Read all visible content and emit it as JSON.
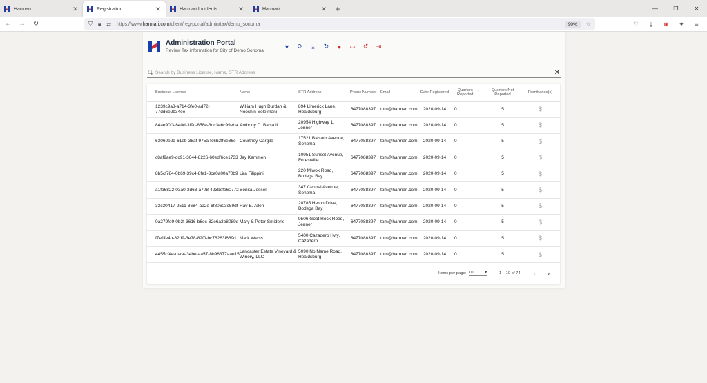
{
  "browser": {
    "tabs": [
      {
        "label": "Harmari",
        "active": false
      },
      {
        "label": "Registration",
        "active": true
      },
      {
        "label": "Harmari Incidents",
        "active": false
      },
      {
        "label": "Harmari",
        "active": false
      }
    ],
    "url_prefix": "https://www.",
    "url_host": "harmari.com",
    "url_path": "/client/reg-portal/admin/tax/demo_sonoma",
    "zoom": "90%"
  },
  "header": {
    "title": "Administration Portal",
    "subtitle": "Review Tax information for City of Demo Sonoma"
  },
  "search": {
    "placeholder": "Search by Business License, Name, STR Address"
  },
  "table": {
    "columns": {
      "license": "Business License",
      "name": "Name",
      "address": "STR Address",
      "phone": "Phone Number",
      "email": "Email",
      "date": "Date Registered",
      "qrep": "Quarters Reported",
      "qnot": "Quarters Not Reported",
      "remit": "Remittance(s)"
    },
    "rows": [
      {
        "license": "1239c9a3-a714-3fe0-ad72-77dd6e2b34ee",
        "name": "William Hugh Durdan & Nooshin Soleimani",
        "address": "894 Limerick Lane, Healdsburg",
        "phone": "6477088397",
        "email": "tom@harmari.com",
        "date": "2020-09-14",
        "qrep": "0",
        "qnot": "5",
        "remit": "$"
      },
      {
        "license": "84ae90f3-840d-3f9c-858e-3dc3e6c99eba",
        "name": "Anthony D. Balsa II",
        "address": "20954 Highway 1, Jenner",
        "phone": "6477088397",
        "email": "tom@harmari.com",
        "date": "2020-09-14",
        "qrep": "0",
        "qnot": "5",
        "remit": "$"
      },
      {
        "license": "63060e2d-61eb-38af-975a-fc6b2ff6e36e",
        "name": "Courtney Cargile",
        "address": "17521 Balsam Avenue, Sonoma",
        "phone": "6477088397",
        "email": "tom@harmari.com",
        "date": "2020-09-14",
        "qrep": "0",
        "qnot": "5",
        "remit": "$"
      },
      {
        "license": "c8af9ae9-dc91-3644-8226-60edf6ce1733",
        "name": "Jay Kammen",
        "address": "10951 Sunset Avenue, Forestville",
        "phone": "6477088397",
        "email": "tom@harmari.com",
        "date": "2020-09-14",
        "qrep": "0",
        "qnot": "5",
        "remit": "$"
      },
      {
        "license": "8b5cf784-0b69-39c4-8fe1-3ce0a00a70b9",
        "name": "Lira Filippini",
        "address": "220 Miwok Road, Bodega Bay",
        "phone": "6477088397",
        "email": "tom@harmari.com",
        "date": "2020-09-14",
        "qrep": "0",
        "qnot": "5",
        "remit": "$"
      },
      {
        "license": "a1fa6822-03a0-3d63-a708-423befe60772",
        "name": "Bonita Jessel",
        "address": "347 Central Avenue, Sonoma",
        "phone": "6477088397",
        "email": "tom@harmari.com",
        "date": "2020-09-14",
        "qrep": "0",
        "qnot": "5",
        "remit": "$"
      },
      {
        "license": "33c30417-2511-3684-a92e-6f80603c59df",
        "name": "Ray E. Allen",
        "address": "20785 Heron Drive, Bodega Bay",
        "phone": "6477088397",
        "email": "tom@harmari.com",
        "date": "2020-09-14",
        "qrep": "0",
        "qnot": "5",
        "remit": "$"
      },
      {
        "license": "0a279fe9-0b2f-3616-b6ec-82e6a3b8089d",
        "name": "Mary & Peter Smiderle",
        "address": "9506 Goat Rock Road, Jenner",
        "phone": "6477088397",
        "email": "tom@harmari.com",
        "date": "2020-09-14",
        "qrep": "0",
        "qnot": "5",
        "remit": "$"
      },
      {
        "license": "f7e1fe4b-82d9-3e78-82f0-bc76263f669d",
        "name": "Mark Weiss",
        "address": "5400 Cazadero Hwy, Cazadero",
        "phone": "6477088397",
        "email": "tom@harmari.com",
        "date": "2020-09-14",
        "qrep": "0",
        "qnot": "5",
        "remit": "$"
      },
      {
        "license": "4455cf4e-dac4-34be-aa57-8b98377aae15",
        "name": "Lancaster Estate Vineyard & Winery, LLC",
        "address": "5090 No Name Road, Healdsburg",
        "phone": "6477088397",
        "email": "tom@harmari.com",
        "date": "2020-09-14",
        "qrep": "0",
        "qnot": "5",
        "remit": "$"
      }
    ]
  },
  "paginator": {
    "items_per_page_label": "Items per page:",
    "items_per_page": "10",
    "range": "1 – 10 of 74"
  },
  "colors": {
    "brand_blue": "#1a3fa8",
    "brand_red": "#d32f2f"
  }
}
